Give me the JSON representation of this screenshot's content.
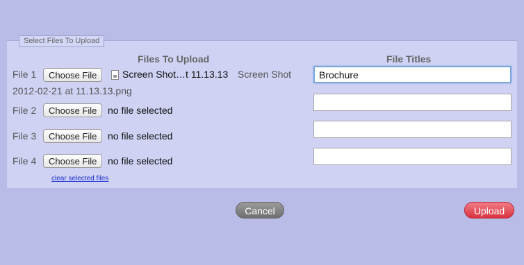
{
  "legend": "Select Files To Upload",
  "headers": {
    "files": "Files To Upload",
    "titles": "File Titles"
  },
  "choose_label": "Choose File",
  "files": [
    {
      "label": "File 1",
      "selected_short": "Screen Shot…t 11.13.13",
      "full_name_part1": "Screen Shot",
      "full_name_part2": "2012-02-21 at 11.13.13.png",
      "title_value": "Brochure"
    },
    {
      "label": "File 2",
      "selected_text": "no file selected",
      "title_value": ""
    },
    {
      "label": "File 3",
      "selected_text": "no file selected",
      "title_value": ""
    },
    {
      "label": "File 4",
      "selected_text": "no file selected",
      "title_value": ""
    }
  ],
  "clear_link": "clear selected files",
  "buttons": {
    "cancel": "Cancel",
    "upload": "Upload"
  }
}
